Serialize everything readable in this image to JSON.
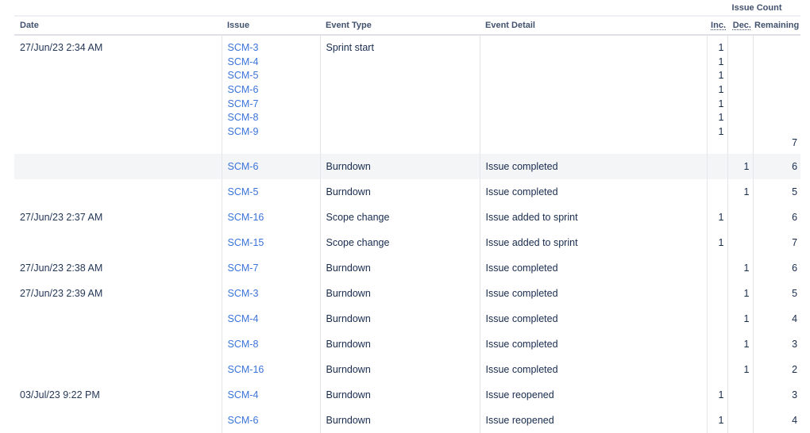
{
  "table": {
    "group_header": "Issue Count",
    "columns": {
      "date": "Date",
      "issue": "Issue",
      "event_type": "Event Type",
      "event_detail": "Event Detail",
      "inc": "Inc.",
      "dec": "Dec.",
      "remaining": "Remaining"
    },
    "sprint_start": {
      "date": "27/Jun/23 2:34 AM",
      "issues": [
        "SCM-3",
        "SCM-4",
        "SCM-5",
        "SCM-6",
        "SCM-7",
        "SCM-8",
        "SCM-9"
      ],
      "event_type": "Sprint start",
      "event_detail": "",
      "inc": [
        "1",
        "1",
        "1",
        "1",
        "1",
        "1",
        "1"
      ],
      "remaining": "7"
    },
    "rows": [
      {
        "date": "",
        "issue": "SCM-6",
        "event_type": "Burndown",
        "event_detail": "Issue completed",
        "inc": "",
        "dec": "1",
        "remaining": "6",
        "highlighted": true
      },
      {
        "date": "",
        "issue": "SCM-5",
        "event_type": "Burndown",
        "event_detail": "Issue completed",
        "inc": "",
        "dec": "1",
        "remaining": "5"
      },
      {
        "date": "27/Jun/23 2:37 AM",
        "issue": "SCM-16",
        "event_type": "Scope change",
        "event_detail": "Issue added to sprint",
        "inc": "1",
        "dec": "",
        "remaining": "6"
      },
      {
        "date": "",
        "issue": "SCM-15",
        "event_type": "Scope change",
        "event_detail": "Issue added to sprint",
        "inc": "1",
        "dec": "",
        "remaining": "7"
      },
      {
        "date": "27/Jun/23 2:38 AM",
        "issue": "SCM-7",
        "event_type": "Burndown",
        "event_detail": "Issue completed",
        "inc": "",
        "dec": "1",
        "remaining": "6"
      },
      {
        "date": "27/Jun/23 2:39 AM",
        "issue": "SCM-3",
        "event_type": "Burndown",
        "event_detail": "Issue completed",
        "inc": "",
        "dec": "1",
        "remaining": "5"
      },
      {
        "date": "",
        "issue": "SCM-4",
        "event_type": "Burndown",
        "event_detail": "Issue completed",
        "inc": "",
        "dec": "1",
        "remaining": "4"
      },
      {
        "date": "",
        "issue": "SCM-8",
        "event_type": "Burndown",
        "event_detail": "Issue completed",
        "inc": "",
        "dec": "1",
        "remaining": "3"
      },
      {
        "date": "",
        "issue": "SCM-16",
        "event_type": "Burndown",
        "event_detail": "Issue completed",
        "inc": "",
        "dec": "1",
        "remaining": "2"
      },
      {
        "date": "03/Jul/23 9:22 PM",
        "issue": "SCM-4",
        "event_type": "Burndown",
        "event_detail": "Issue reopened",
        "inc": "1",
        "dec": "",
        "remaining": "3"
      },
      {
        "date": "",
        "issue": "SCM-6",
        "event_type": "Burndown",
        "event_detail": "Issue reopened",
        "inc": "1",
        "dec": "",
        "remaining": "4"
      }
    ]
  },
  "colors": {
    "link": "#3b73d9",
    "text": "#172b4d",
    "header_text": "#42526e",
    "highlight_row": "#f4f5f7",
    "border": "#e4e6ea"
  }
}
